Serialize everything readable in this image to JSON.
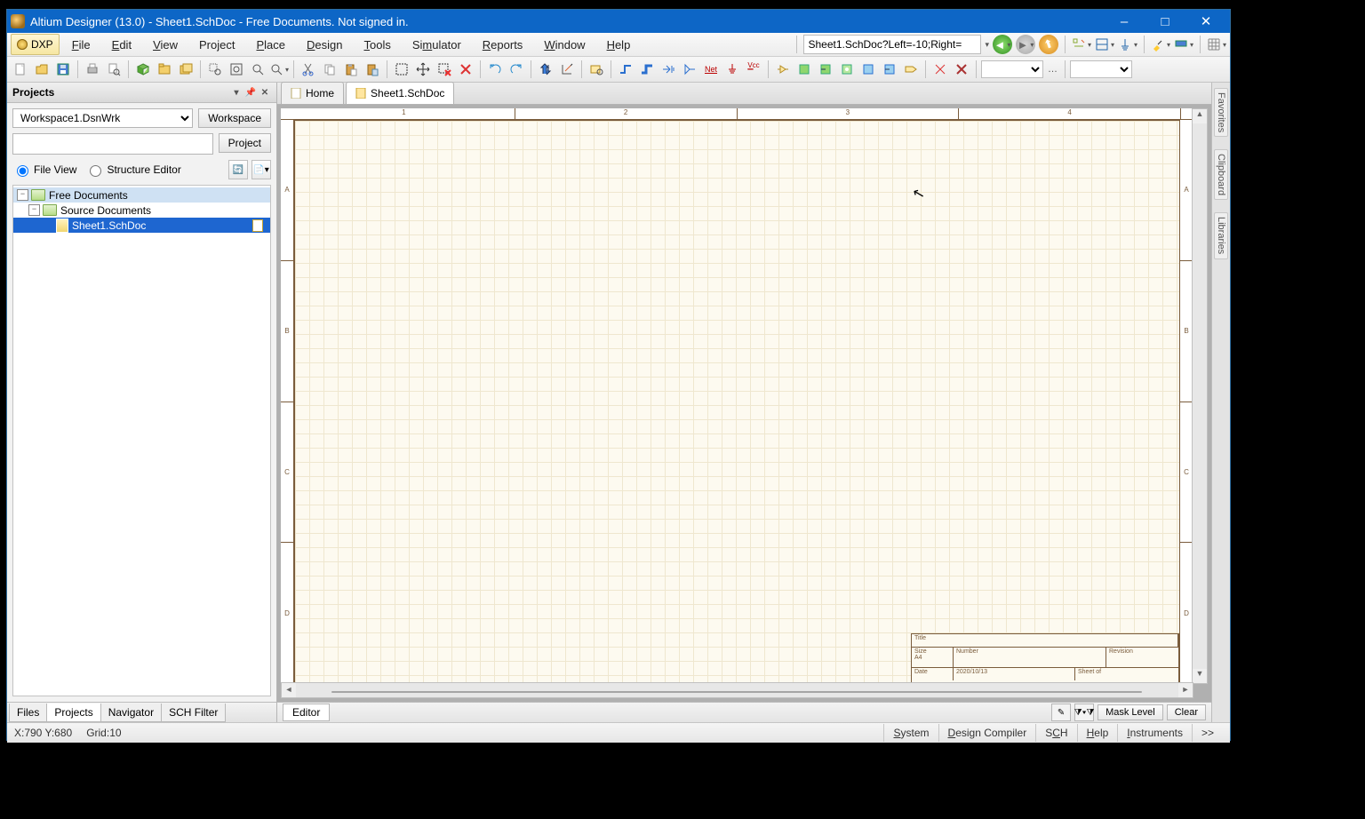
{
  "title": "Altium Designer (13.0) - Sheet1.SchDoc - Free Documents. Not signed in.",
  "menu": {
    "dxp": "DXP",
    "file": "File",
    "edit": "Edit",
    "view": "View",
    "project": "Project",
    "place": "Place",
    "design": "Design",
    "tools": "Tools",
    "simulator": "Simulator",
    "reports": "Reports",
    "window": "Window",
    "help": "Help"
  },
  "addressbar": "Sheet1.SchDoc?Left=-10;Right=",
  "projects_panel": {
    "title": "Projects",
    "workspace_dropdown": "Workspace1.DsnWrk",
    "workspace_btn": "Workspace",
    "project_btn": "Project",
    "file_view": "File View",
    "structure_editor": "Structure Editor",
    "tree": {
      "root": "Free Documents",
      "group": "Source Documents",
      "doc": "Sheet1.SchDoc"
    }
  },
  "panel_tabs": {
    "files": "Files",
    "projects": "Projects",
    "navigator": "Navigator",
    "sch_filter": "SCH Filter"
  },
  "doc_tabs": {
    "home": "Home",
    "sheet1": "Sheet1.SchDoc"
  },
  "sheet": {
    "cols": [
      "1",
      "2",
      "3",
      "4"
    ],
    "rows": [
      "A",
      "B",
      "C",
      "D"
    ],
    "titleblock": {
      "title": "Title",
      "size": "Size",
      "sizeval": "A4",
      "number": "Number",
      "revision": "Revision",
      "date": "Date",
      "dateval": "2020/10/13",
      "sheet": "Sheet  of"
    }
  },
  "editor_bottom": {
    "label": "Editor",
    "mask_level": "Mask Level",
    "clear": "Clear"
  },
  "right_tabs": {
    "fav": "Favorites",
    "clip": "Clipboard",
    "lib": "Libraries"
  },
  "status": {
    "coords": "X:790 Y:680",
    "grid": "Grid:10",
    "system": "System",
    "design_compiler": "Design Compiler",
    "sch": "SCH",
    "help": "Help",
    "instruments": "Instruments",
    "more": ">>"
  }
}
